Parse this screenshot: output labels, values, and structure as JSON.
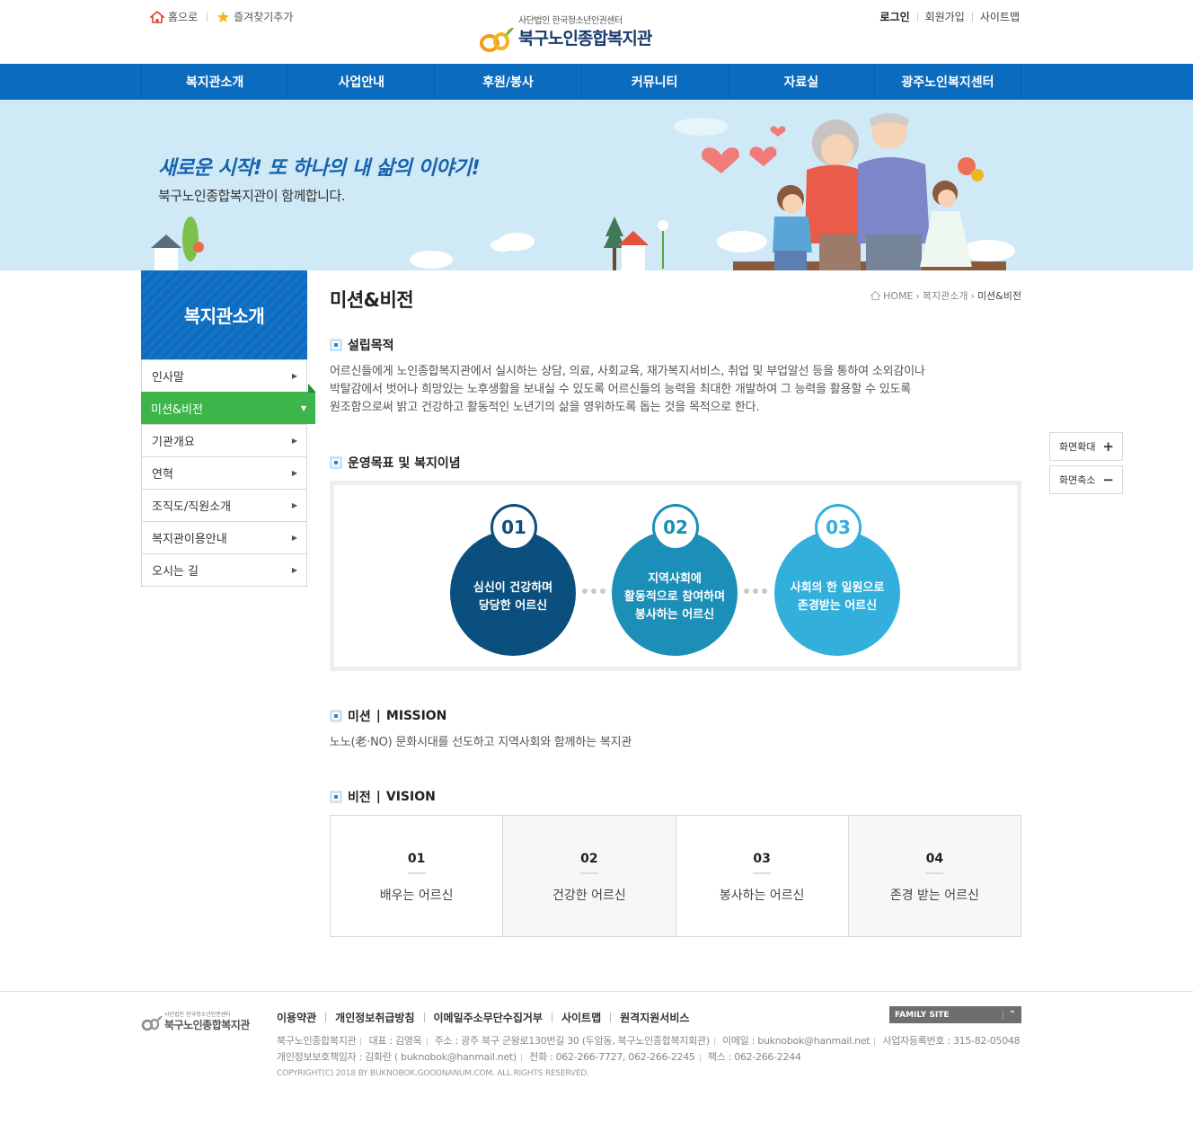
{
  "top_util": {
    "home": "홈으로",
    "bookmark": "즐겨찾기추가",
    "login": "로그인",
    "join": "회원가입",
    "sitemap": "사이트맵"
  },
  "logo": {
    "sub": "사단법인 한국청소년인권센터",
    "main": "북구노인종합복지관"
  },
  "gnb": [
    "복지관소개",
    "사업안내",
    "후원/봉사",
    "커뮤니티",
    "자료실",
    "광주노인복지센터"
  ],
  "visual": {
    "slogan": "새로운 시작! 또 하나의 내 삶의 이야기!",
    "sub": "북구노인종합복지관이 함께합니다."
  },
  "lnb": {
    "title": "복지관소개",
    "items": [
      "인사말",
      "미션&비전",
      "기관개요",
      "연혁",
      "조직도/직원소개",
      "복지관이용안내",
      "오시는 길"
    ]
  },
  "page": {
    "title": "미션&비전",
    "breadcrumb": [
      "HOME",
      "복지관소개",
      "미션&비전"
    ]
  },
  "purpose": {
    "title": "설립목적",
    "lines": [
      "어르신들에게 노인종합복지관에서 실시하는 상담, 의료, 사회교육, 재가복지서비스, 취업 및 부업알선 등을 통하여 소외감이나",
      "박탈감에서 벗어나 희망있는 노후생활을 보내실 수 있도록 어르신들의 능력을 최대한 개발하여 그 능력을 활용할 수 있도록",
      "원조함으로써 밝고 건강하고 활동적인 노년기의 삶을 영위하도록 돕는 것을 목적으로 한다."
    ]
  },
  "goals": {
    "title": "운영목표 및 복지이념",
    "items": [
      {
        "num": "01",
        "text": "심신이 건강하며\n당당한 어르신",
        "color": "#0b4f7e"
      },
      {
        "num": "02",
        "text": "지역사회에\n활동적으로 참여하며\n봉사하는 어르신",
        "color": "#1b8fb7"
      },
      {
        "num": "03",
        "text": "사회의 한 일원으로\n존경받는 어르신",
        "color": "#33afdc"
      }
    ]
  },
  "mission": {
    "title": "미션",
    "title_en": "MISSION",
    "text": "노노(老·NO) 문화시대를 선도하고 지역사회와 함께하는 복지관"
  },
  "vision": {
    "title": "비전",
    "title_en": "VISION",
    "items": [
      {
        "num": "01",
        "label": "배우는 어르신"
      },
      {
        "num": "02",
        "label": "건강한 어르신"
      },
      {
        "num": "03",
        "label": "봉사하는 어르신"
      },
      {
        "num": "04",
        "label": "존경 받는 어르신"
      }
    ]
  },
  "zoom": {
    "in": "화면확대",
    "out": "화면축소"
  },
  "footer": {
    "logo_sub": "사단법인 한국청소년인권센터",
    "logo_main": "북구노인종합복지관",
    "links": [
      "이용약관",
      "개인정보취급방침",
      "이메일주소무단수집거부",
      "사이트맵",
      "원격지원서비스"
    ],
    "info1": [
      "북구노인종합복지관",
      "대표 : 김영옥",
      "주소 : 광주 북구 군왕로130번길 30 (두암동, 북구노인종합복지회관)",
      "이메일 : buknobok@hanmail.net",
      "사업자등록번호 : 315-82-05048"
    ],
    "info2": [
      "개인정보보호책임자 : 김화란 ( buknobok@hanmail.net)",
      "전화 : 062-266-7727, 062-266-2245",
      "팩스 : 062-266-2244"
    ],
    "copyright": "COPYRIGHT(C) 2018 BY BUKNOBOK.GOODNANUM.COM. ALL RIGHTS RESERVED.",
    "family_site": "FAMILY SITE"
  }
}
